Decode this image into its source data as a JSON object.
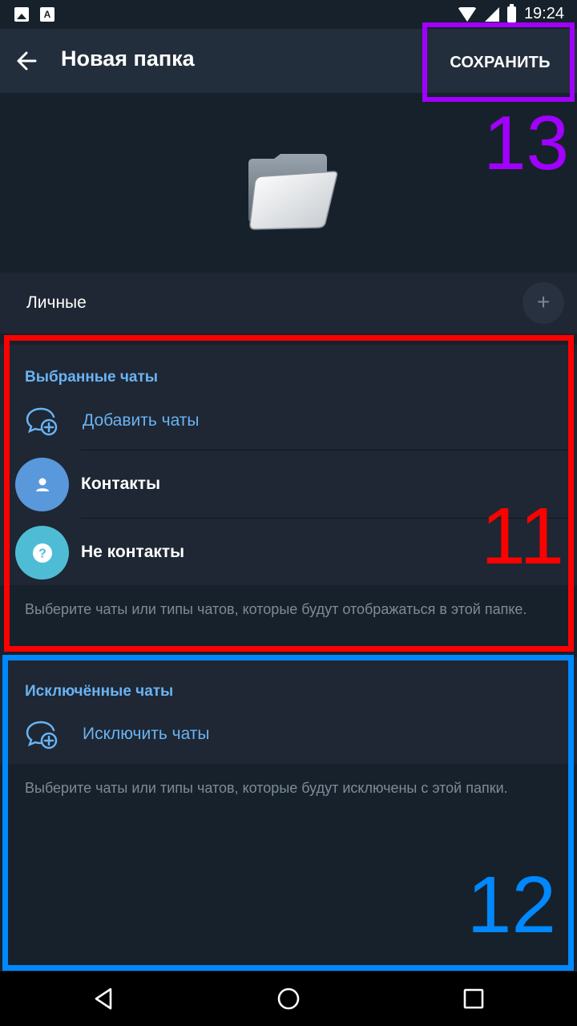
{
  "status_bar": {
    "time": "19:24",
    "icons": [
      "image-icon",
      "font-icon",
      "wifi-icon",
      "signal-icon",
      "battery-icon"
    ]
  },
  "toolbar": {
    "title": "Новая папка",
    "save_label": "СОХРАНИТЬ",
    "back_icon": "arrow-left-icon"
  },
  "folder": {
    "name": "Личные",
    "emoji_button": "+"
  },
  "included": {
    "header": "Выбранные чаты",
    "add_label": "Добавить чаты",
    "items": [
      {
        "label": "Контакты",
        "icon": "person-icon",
        "color": "#5a98dc"
      },
      {
        "label": "Не контакты",
        "icon": "question-icon",
        "color": "#4fbcd6"
      }
    ],
    "hint": "Выберите чаты или типы чатов, которые будут отображаться в этой папке."
  },
  "excluded": {
    "header": "Исключённые чаты",
    "add_label": "Исключить чаты",
    "hint": "Выберите чаты или типы чатов, которые будут исключены с этой папки."
  },
  "annotations": [
    {
      "label": "13",
      "color": "#a100ff"
    },
    {
      "label": "11",
      "color": "#ff0000"
    },
    {
      "label": "12",
      "color": "#0088ff"
    }
  ],
  "colors": {
    "accent": "#6ab3f3",
    "toolbar_bg": "#232e3c",
    "page_bg": "#17212b",
    "section_bg": "#1e2733"
  }
}
